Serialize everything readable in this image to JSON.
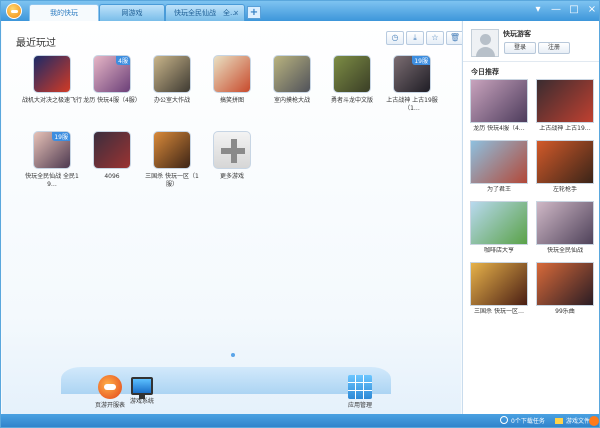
{
  "window": {
    "tabs": [
      {
        "label": "我的快玩",
        "active": true
      },
      {
        "label": "网游戏",
        "active": false
      },
      {
        "label": "快玩全民仙战　全…",
        "active": false
      }
    ],
    "tab_close_glyph": "×",
    "tab_add_glyph": "+",
    "controls": {
      "menu": "▾",
      "minimize": "—",
      "maximize": "□",
      "close": "×"
    }
  },
  "main": {
    "section_title": "最近玩过",
    "toolbar_icons": [
      "clock-icon",
      "download-icon",
      "star-icon",
      "trash-icon"
    ],
    "toolbar_glyphs": [
      "◷",
      "⤓",
      "☆",
      "🗑"
    ],
    "games": [
      {
        "label": "战机大对决之极速飞行",
        "colors": [
          "#1b2a68",
          "#d23a24"
        ]
      },
      {
        "label": "龙历 快玩4服（4服）",
        "badge": "4服",
        "colors": [
          "#e6b6c6",
          "#6b3f78"
        ]
      },
      {
        "label": "办公室大作战",
        "colors": [
          "#c9b58a",
          "#3e3a32"
        ]
      },
      {
        "label": "搞笑拼图",
        "colors": [
          "#e9e1c4",
          "#c84a2c"
        ]
      },
      {
        "label": "室内摸枪大战",
        "colors": [
          "#b9b37f",
          "#50525a"
        ]
      },
      {
        "label": "勇者斗龙中文版",
        "colors": [
          "#7d8d45",
          "#3a3e26"
        ]
      },
      {
        "label": "上古战神 上古19服（1…",
        "badge": "19服",
        "colors": [
          "#7b6d72",
          "#1f1d25"
        ]
      },
      {
        "label": "快玩全民仙战 全民19…",
        "badge": "19服",
        "colors": [
          "#e7c2b7",
          "#4d3950"
        ]
      },
      {
        "label": "4096",
        "colors": [
          "#3b2e3e",
          "#9b3332"
        ]
      },
      {
        "label": "三国杀 快玩一区（1服）",
        "colors": [
          "#d98a3a",
          "#3d2416"
        ]
      },
      {
        "label": "更多游戏",
        "more": true
      }
    ],
    "dock": [
      {
        "label": "页游开服表",
        "icon": "gamepad-icon"
      },
      {
        "label": "游戏系统",
        "icon": "monitor-icon"
      },
      {
        "label": "应用管理",
        "icon": "apps-grid-icon"
      }
    ]
  },
  "sidebar": {
    "username": "快玩游客",
    "login_label": "登录",
    "register_label": "注册",
    "recommend_title": "今日推荐",
    "items": [
      {
        "label": "龙历 快玩4服（4…",
        "colors": [
          "#c8a3bd",
          "#4d3c5c"
        ]
      },
      {
        "label": "上古战神 上古19…",
        "colors": [
          "#3a2c30",
          "#c04030"
        ]
      },
      {
        "label": "为了君王",
        "colors": [
          "#8ec0df",
          "#b24838"
        ]
      },
      {
        "label": "左轮枪手",
        "colors": [
          "#d25a2a",
          "#3a2418"
        ]
      },
      {
        "label": "咖啡店大亨",
        "colors": [
          "#b8d9ef",
          "#5aa248"
        ]
      },
      {
        "label": "快玩全民仙战",
        "colors": [
          "#cfb8c6",
          "#4f425a"
        ]
      },
      {
        "label": "三国杀 快玩一区…",
        "colors": [
          "#e7b24a",
          "#4a1e14"
        ]
      },
      {
        "label": "99乐曲",
        "colors": [
          "#d86a3a",
          "#2a1c24"
        ]
      }
    ]
  },
  "status": {
    "downloads": "0个下载任务",
    "folder": "游戏文件夹"
  }
}
